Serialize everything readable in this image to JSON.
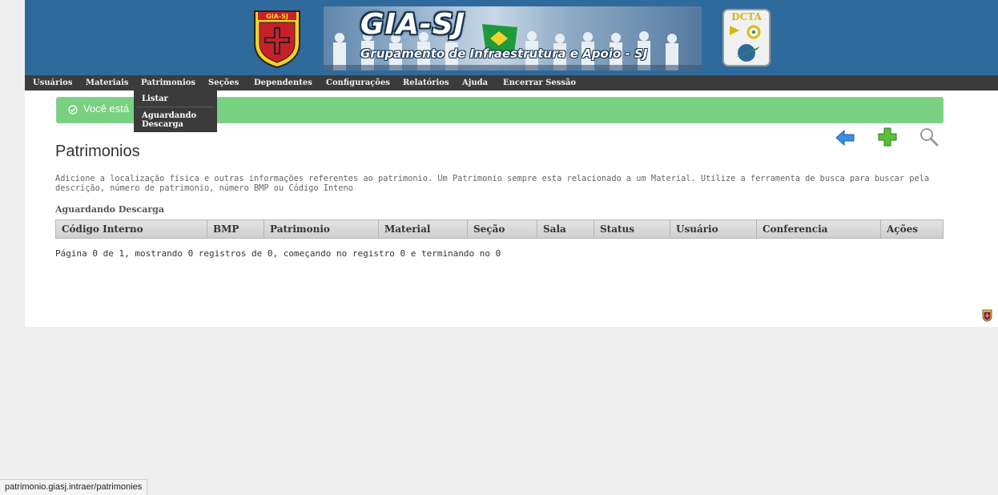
{
  "banner": {
    "title": "GIA-SJ",
    "subtitle": "Grupamento de Infraestrutura e Apoio - SJ",
    "gia_badge_text": "GIA-SJ",
    "dcta_badge_text": "DCTA",
    "bg_color": "#2f6a9d"
  },
  "nav": {
    "items": [
      {
        "label": "Usuários"
      },
      {
        "label": "Materiais"
      },
      {
        "label": "Patrimonios"
      },
      {
        "label": "Seções"
      },
      {
        "label": "Dependentes"
      },
      {
        "label": "Configurações"
      },
      {
        "label": "Relatórios"
      },
      {
        "label": "Ajuda"
      },
      {
        "label": "Encerrar Sessão"
      }
    ],
    "open_menu": "Patrimonios",
    "dropdown": {
      "items": [
        {
          "label": "Listar"
        },
        {
          "label_line1": "Aguardando",
          "label_line2": "Descarga"
        }
      ]
    }
  },
  "alert": {
    "text": "Você está",
    "color": "#78d180"
  },
  "toolbar": {
    "icons": [
      "arrow-left-icon",
      "plus-icon",
      "search-icon"
    ]
  },
  "main": {
    "title": "Patrimonios",
    "description": "Adicione a localização física e outras informações referentes ao patrimonio. Um Patrimonio sempre esta relacionado a um Material. Utilize a ferramenta de busca para buscar pela descrição, número de patrimonio, número BMP ou Código Inteno",
    "section_label": "Aguardando Descarga",
    "table": {
      "columns": [
        "Código Interno",
        "BMP",
        "Patrimonio",
        "Material",
        "Seção",
        "Sala",
        "Status",
        "Usuário",
        "Conferencia",
        "Ações"
      ],
      "rows": []
    },
    "pagination": "Página 0 de 1, mostrando 0 registros de 0, começando no registro 0 e terminando no 0"
  },
  "statusbar": {
    "url": "patrimonio.giasj.intraer/patrimonies"
  }
}
